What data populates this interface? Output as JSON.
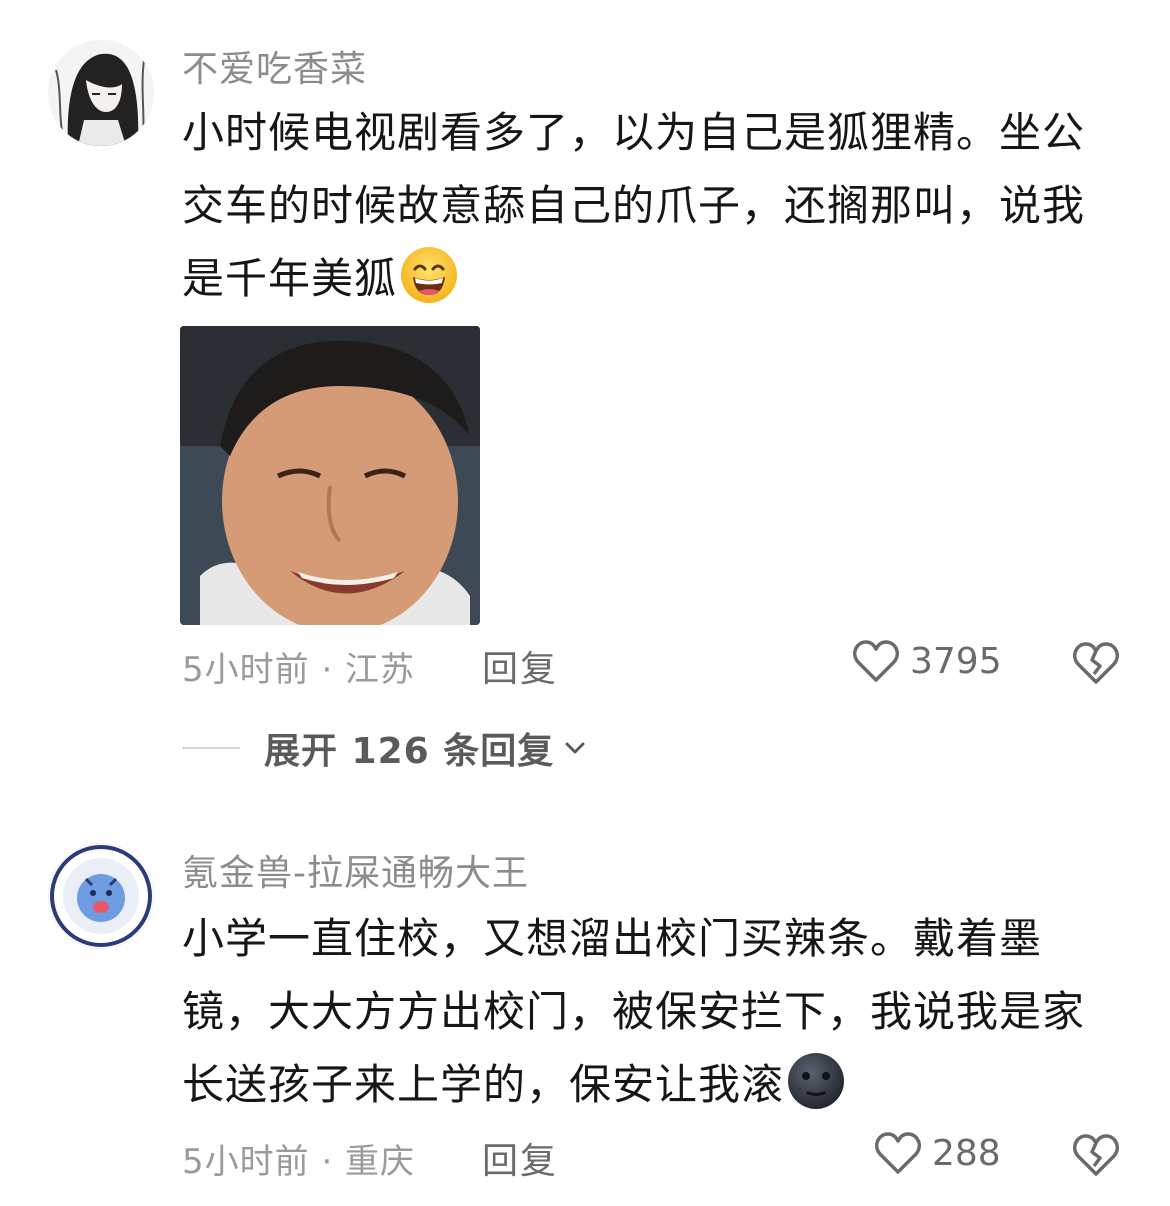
{
  "comments": [
    {
      "username": "不爱吃香菜",
      "text_lines": [
        "小时候电视剧看多了，以为自己是狐狸精。坐公",
        "交车的时候故意舔自己的爪子，还搁那叫，说我",
        "是千年美狐"
      ],
      "emoji": "grinning-sweat-emoji",
      "has_photo": true,
      "time_location": "5小时前 · 江苏",
      "reply_label": "回复",
      "like_count": "3795",
      "expand_label": "展开 126 条回复"
    },
    {
      "username": "氪金兽-拉屎通畅大王",
      "text_lines": [
        "小学一直住校，又想溜出校门买辣条。戴着墨",
        "镜，大大方方出校门，被保安拦下，我说我是家",
        "长送孩子来上学的，保安让我滚"
      ],
      "emoji": "dark-moon-face-emoji",
      "time_location": "5小时前 · 重庆",
      "reply_label": "回复",
      "like_count": "288"
    }
  ],
  "colors": {
    "username": "#8c8c8c",
    "body_text": "#161616",
    "meta": "#9a9a9a",
    "icon": "#6a6a6a"
  }
}
